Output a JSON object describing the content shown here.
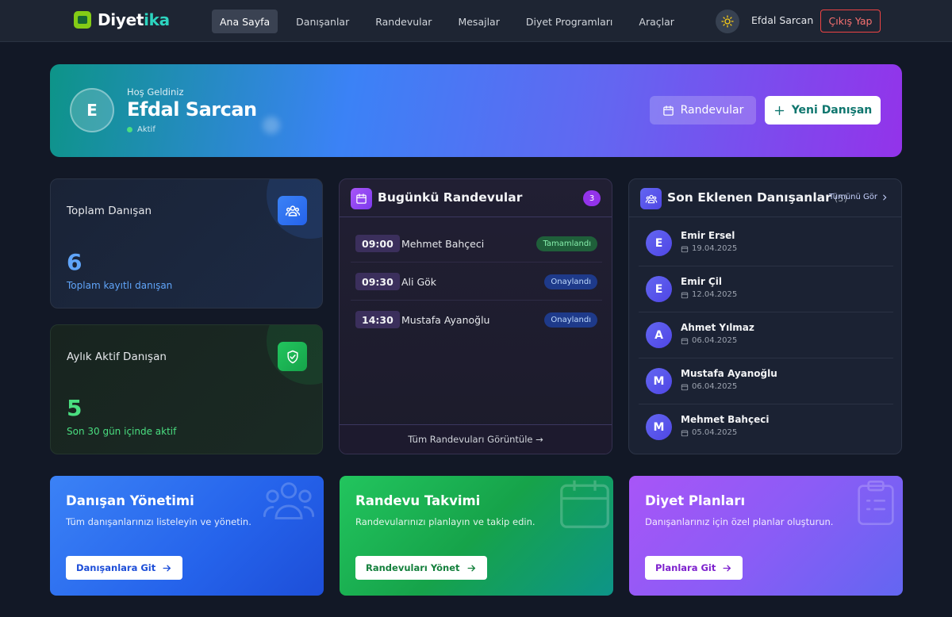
{
  "nav": {
    "brand_main": "Diyet",
    "brand_accent": "ika",
    "links": [
      {
        "label": "Ana Sayfa",
        "active": true
      },
      {
        "label": "Danışanlar",
        "active": false
      },
      {
        "label": "Randevular",
        "active": false
      },
      {
        "label": "Mesajlar",
        "active": false
      },
      {
        "label": "Diyet Programları",
        "active": false
      },
      {
        "label": "Araçlar",
        "active": false
      }
    ],
    "theme_icon": "sun-icon",
    "user_name": "Efdal Sarcan",
    "logout_label": "Çıkış Yap"
  },
  "hero": {
    "avatar_initial": "E",
    "greeting": "Hoş Geldiniz",
    "name": "Efdal Sarcan",
    "status": "Aktif",
    "appointments_button": "Randevular",
    "new_client_button": "Yeni Danışan"
  },
  "stats": {
    "total": {
      "label": "Toplam Danışan",
      "value": "6",
      "subtitle": "Toplam kayıtlı danışan",
      "icon": "users-icon"
    },
    "active": {
      "label": "Aylık Aktif Danışan",
      "value": "5",
      "subtitle": "Son 30 gün içinde aktif",
      "icon": "shield-check-icon"
    }
  },
  "appointments": {
    "title": "Bugünkü Randevular",
    "count": "3",
    "items": [
      {
        "time": "09:00",
        "name": "Mehmet Bahçeci",
        "status": "Tamamlandı",
        "status_type": "done"
      },
      {
        "time": "09:30",
        "name": "Ali Gök",
        "status": "Onaylandı",
        "status_type": "confirmed"
      },
      {
        "time": "14:30",
        "name": "Mustafa Ayanoğlu",
        "status": "Onaylandı",
        "status_type": "confirmed"
      }
    ],
    "footer_link": "Tüm Randevuları Görüntüle →"
  },
  "recent_clients": {
    "title": "Son Eklenen Danışanlar",
    "count": "(5)",
    "see_all": "Tümünü Gör",
    "items": [
      {
        "initial": "E",
        "name": "Emir Ersel",
        "date": "19.04.2025"
      },
      {
        "initial": "E",
        "name": "Emir Çil",
        "date": "12.04.2025"
      },
      {
        "initial": "A",
        "name": "Ahmet Yılmaz",
        "date": "06.04.2025"
      },
      {
        "initial": "M",
        "name": "Mustafa Ayanoğlu",
        "date": "06.04.2025"
      },
      {
        "initial": "M",
        "name": "Mehmet Bahçeci",
        "date": "05.04.2025"
      }
    ]
  },
  "action_cards": [
    {
      "title": "Danışan Yönetimi",
      "description": "Tüm danışanlarınızı listeleyin ve yönetin.",
      "button": "Danışanlara Git",
      "icon": "users-icon"
    },
    {
      "title": "Randevu Takvimi",
      "description": "Randevularınızı planlayın ve takip edin.",
      "button": "Randevuları Yönet",
      "icon": "calendar-icon"
    },
    {
      "title": "Diyet Planları",
      "description": "Danışanlarınız için özel planlar oluşturun.",
      "button": "Planlara Git",
      "icon": "clipboard-icon"
    }
  ],
  "colors": {
    "background": "#121826",
    "accent_teal": "#2dd4bf",
    "status_done": "#1f5f3a",
    "status_confirmed": "#1e3a8a",
    "logout_red": "#ef4444"
  }
}
